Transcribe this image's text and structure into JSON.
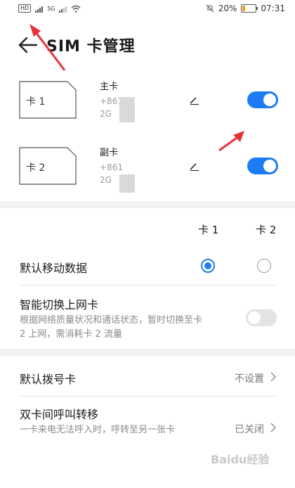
{
  "status_bar": {
    "battery": "20%",
    "time": "07:31",
    "net_label": "5G",
    "battery_level": 0.2
  },
  "header": {
    "title": "SIM 卡管理"
  },
  "sims": [
    {
      "card_label": "卡 1",
      "role": "主卡",
      "number": "+861",
      "network": "2G",
      "enabled": true
    },
    {
      "card_label": "卡 2",
      "role": "副卡",
      "number": "+861",
      "network": "2G",
      "enabled": true
    }
  ],
  "columns": {
    "card1": "卡 1",
    "card2": "卡 2"
  },
  "default_data": {
    "title": "默认移动数据",
    "selected": "card1"
  },
  "smart_switch": {
    "title": "智能切换上网卡",
    "desc": "根据网络质量状况和通话状态，暂时切换至卡 2 上网，需消耗卡 2 流量",
    "enabled": false
  },
  "default_dial": {
    "title": "默认拨号卡",
    "value": "不设置"
  },
  "call_forward": {
    "title": "双卡间呼叫转移",
    "desc": "一卡来电无法呼入时，呼转至另一张卡",
    "value": "已关闭"
  },
  "watermark": "Baidu经验",
  "colors": {
    "accent": "#1c7cf4",
    "annotation_arrow": "#e8323a"
  }
}
